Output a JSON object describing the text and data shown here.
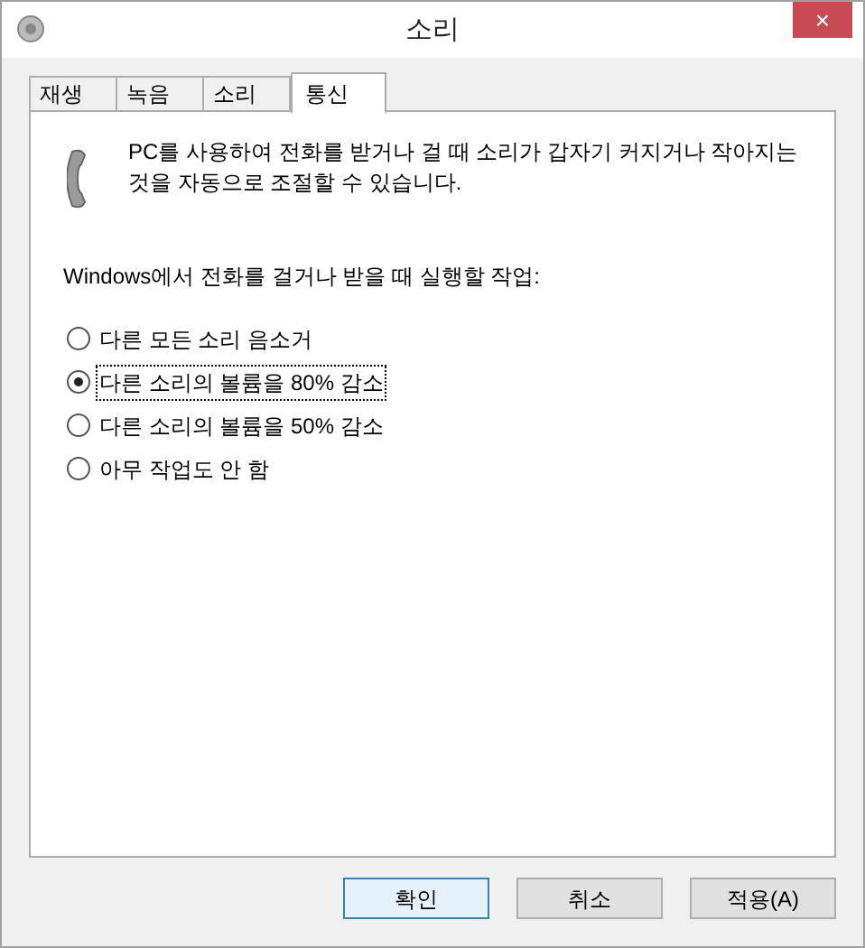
{
  "window": {
    "title": "소리",
    "close": "×"
  },
  "tabs": [
    {
      "label": "재생",
      "selected": false
    },
    {
      "label": "녹음",
      "selected": false
    },
    {
      "label": "소리",
      "selected": false
    },
    {
      "label": "통신",
      "selected": true
    }
  ],
  "description": "PC를 사용하여 전화를 받거나 걸 때 소리가 갑자기 커지거나 작아지는 것을 자동으로 조절할 수 있습니다.",
  "prompt": "Windows에서 전화를 걸거나 받을 때 실행할 작업:",
  "options": [
    {
      "label": "다른 모든 소리 음소거",
      "selected": false
    },
    {
      "label": "다른 소리의 볼륨을 80% 감소",
      "selected": true
    },
    {
      "label": "다른 소리의 볼륨을 50% 감소",
      "selected": false
    },
    {
      "label": "아무 작업도 안 함",
      "selected": false
    }
  ],
  "buttons": [
    {
      "label": "확인",
      "default": true
    },
    {
      "label": "취소",
      "default": false
    },
    {
      "label": "적용(A)",
      "default": false
    }
  ]
}
